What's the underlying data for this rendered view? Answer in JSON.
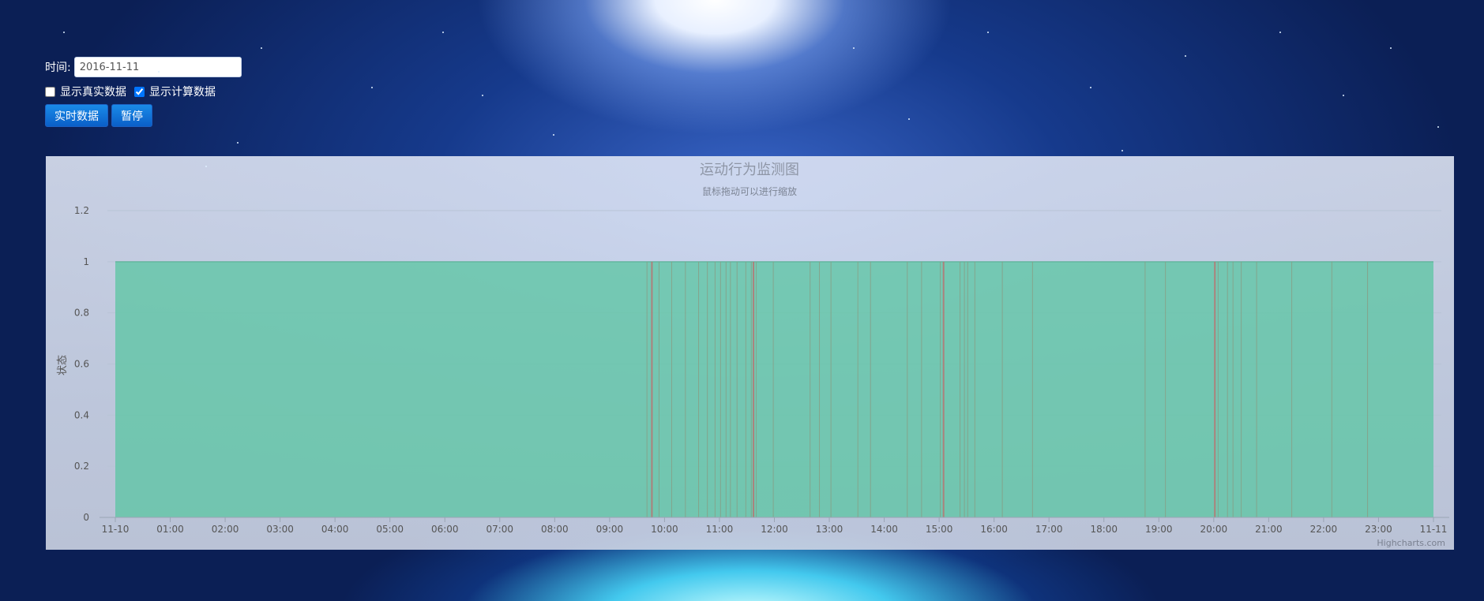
{
  "controls": {
    "date_label": "时间:",
    "date_value": "2016-11-11",
    "show_real_label": "显示真实数据",
    "show_real_checked": false,
    "show_calc_label": "显示计算数据",
    "show_calc_checked": true,
    "realtime_button": "实时数据",
    "pause_button": "暂停"
  },
  "chart_data": {
    "type": "area",
    "title": "运动行为监测图",
    "subtitle": "鼠标拖动可以进行缩放",
    "xlabel": "",
    "ylabel": "状态",
    "x_tick_labels": [
      "11-10",
      "01:00",
      "02:00",
      "03:00",
      "04:00",
      "05:00",
      "06:00",
      "07:00",
      "08:00",
      "09:00",
      "10:00",
      "11:00",
      "12:00",
      "13:00",
      "14:00",
      "15:00",
      "16:00",
      "17:00",
      "18:00",
      "19:00",
      "20:00",
      "21:00",
      "22:00",
      "23:00",
      "11-11"
    ],
    "y_tick_labels": [
      "0",
      "0.2",
      "0.4",
      "0.6",
      "0.8",
      "1",
      "1.2"
    ],
    "xlim_hours": [
      0,
      24
    ],
    "ylim": [
      0,
      1.2
    ],
    "grid": true,
    "series": [
      {
        "values_description_free": true,
        "fill_color": "#5ec5a4",
        "x_hours": [
          0.0,
          24.0
        ],
        "y": [
          1,
          1
        ]
      }
    ],
    "dip_times_hours": [
      9.68,
      9.77,
      9.9,
      10.13,
      10.38,
      10.62,
      10.78,
      10.92,
      11.02,
      11.12,
      11.2,
      11.32,
      11.48,
      11.58,
      11.62,
      11.67,
      11.98,
      12.65,
      12.82,
      13.03,
      13.52,
      13.75,
      14.42,
      14.68,
      15.02,
      15.08,
      15.38,
      15.46,
      15.52,
      15.65,
      16.15,
      16.7,
      18.75,
      19.12,
      20.02,
      20.08,
      20.25,
      20.35,
      20.5,
      20.78,
      21.42,
      22.15,
      22.8
    ],
    "dip_highlight_hours": [
      9.77,
      11.62,
      15.08,
      20.02
    ]
  },
  "credits": "Highcharts.com",
  "colors": {
    "area_fill": "#5ec5a4",
    "dip_line": "#8a9a80",
    "dip_highlight": "#c06a6a",
    "grid": "#b8c4d6",
    "axis_text": "#555555"
  }
}
